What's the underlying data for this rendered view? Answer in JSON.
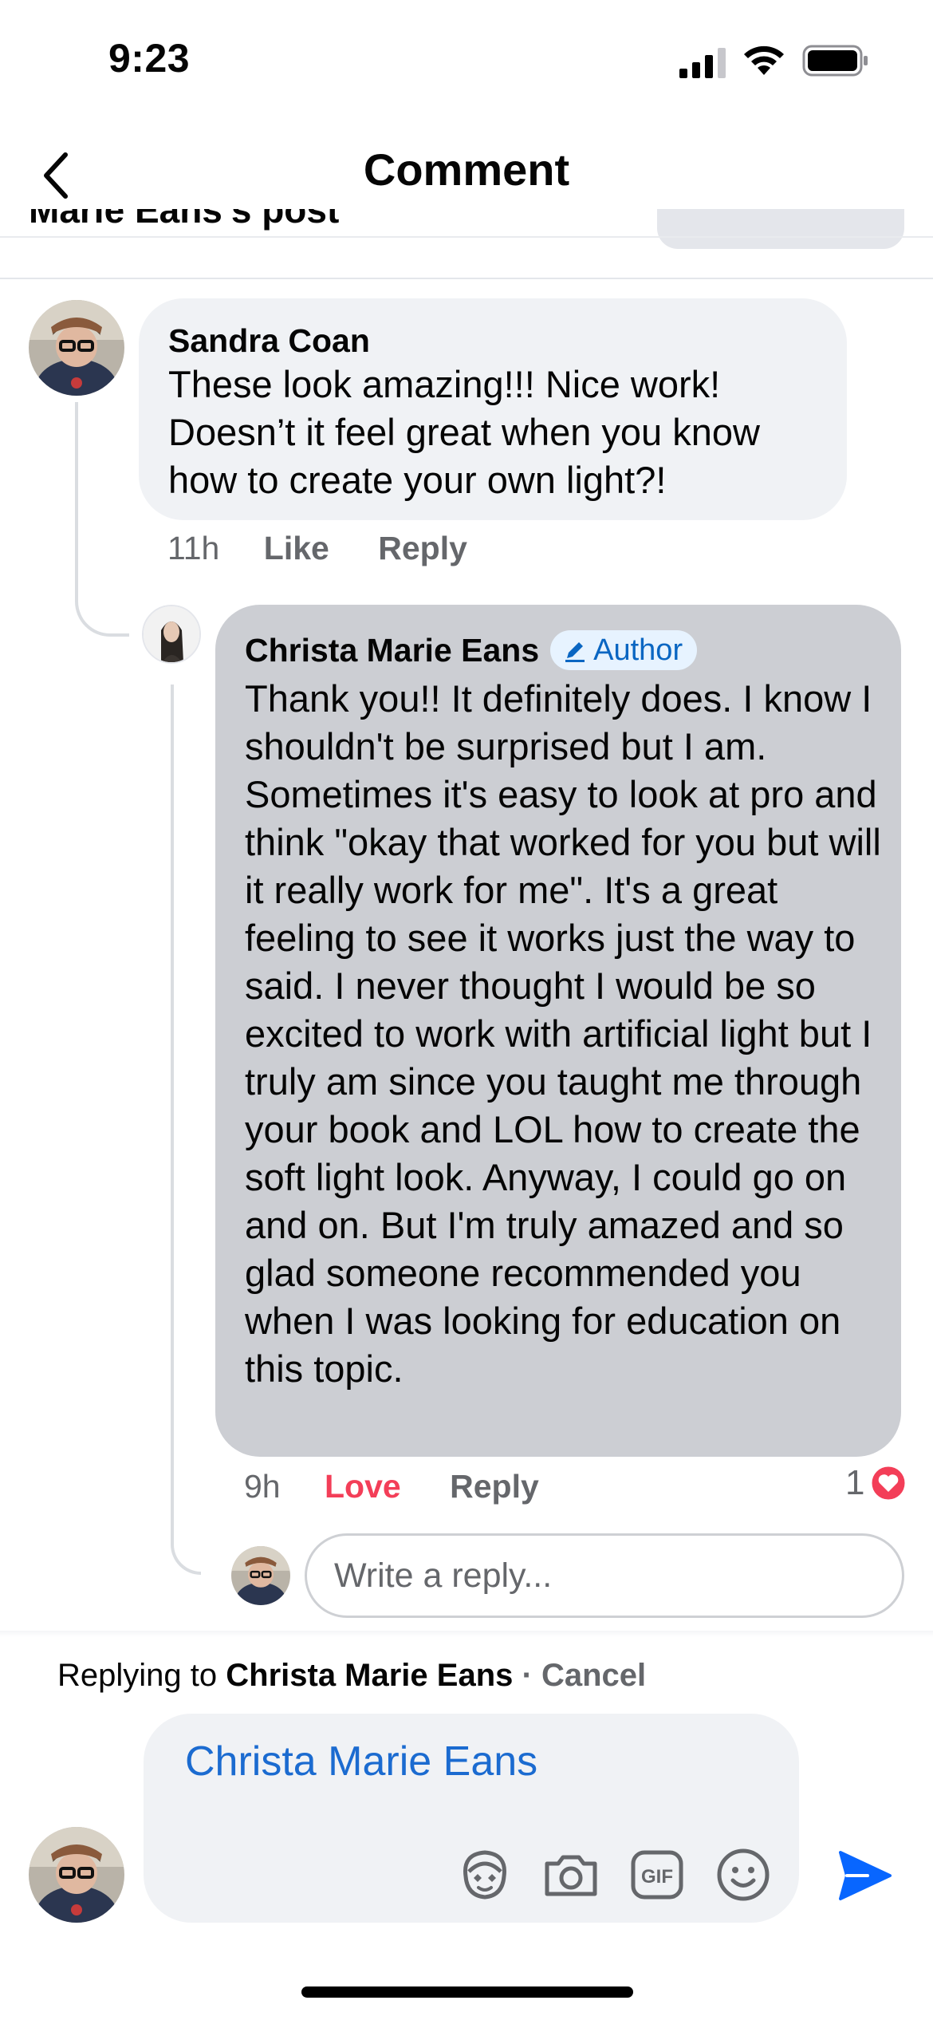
{
  "status_bar": {
    "time": "9:23"
  },
  "header": {
    "title": "Comment",
    "peek_text": "Marie Eans's post"
  },
  "comments": [
    {
      "author": "Sandra Coan",
      "text": "These look amazing!!!  Nice work! Doesn’t it feel great when you know how to create your own light?!",
      "time": "11h",
      "like_label": "Like",
      "reply_label": "Reply"
    },
    {
      "author": "Christa Marie Eans",
      "badge": "Author",
      "text": "Thank you!! It definitely does. I know I shouldn't be surprised but I am. Sometimes it's easy to look at pro and think \"okay that worked for you but will it really work for me\". It's a great feeling to see it works just the way to said. I never thought I would be so excited to work with artificial light but I truly am since you taught me through your book and LOL how to create the soft light look. Anyway, I could go on and on. But I'm truly amazed and so glad someone recommended you when I was looking for education on this topic.",
      "time": "9h",
      "reaction_label": "Love",
      "reply_label": "Reply",
      "reaction_count": "1"
    }
  ],
  "reply_box": {
    "placeholder": "Write a reply..."
  },
  "replying_bar": {
    "prefix": "Replying to",
    "target": "Christa Marie Eans",
    "separator": " · ",
    "cancel": "Cancel"
  },
  "composer": {
    "mention": "Christa Marie Eans",
    "tools": [
      "avatar-sticker-icon",
      "camera-icon",
      "gif-icon",
      "emoji-icon"
    ],
    "send_icon": "send-icon"
  },
  "colors": {
    "brand_blue": "#0866ff",
    "love_red": "#f33e58",
    "bubble_gray": "#f0f2f5",
    "bubble_highlight": "#ccced3"
  }
}
